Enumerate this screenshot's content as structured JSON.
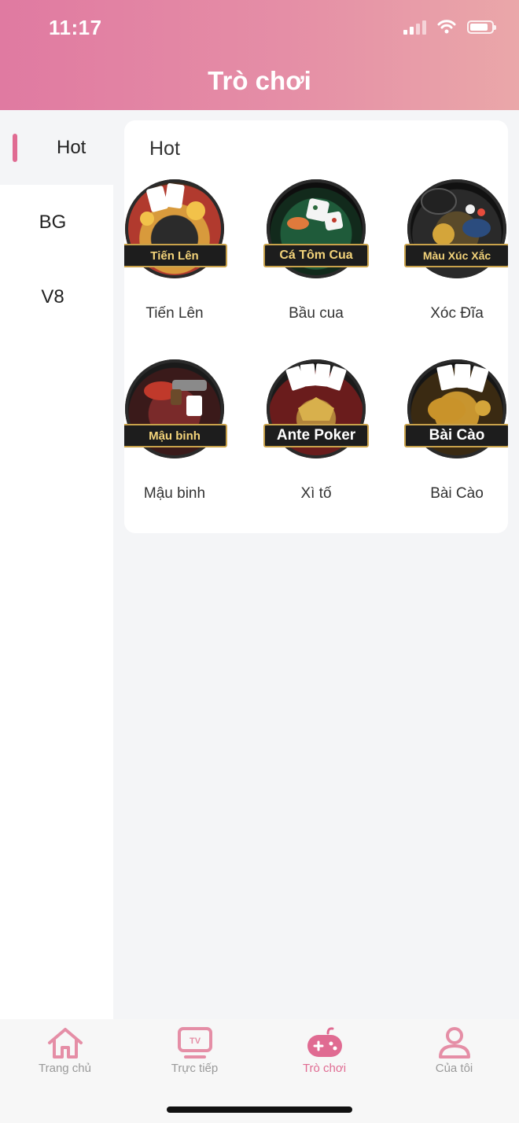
{
  "status": {
    "time": "11:17"
  },
  "header": {
    "title": "Trò chơi"
  },
  "sidebar": {
    "items": [
      {
        "label": "Hot",
        "active": true
      },
      {
        "label": "BG",
        "active": false
      },
      {
        "label": "V8",
        "active": false
      }
    ]
  },
  "section": {
    "title": "Hot",
    "games": [
      {
        "label": "Tiến Lên",
        "badge": "Tiến Lên",
        "icon": "tien-len-icon"
      },
      {
        "label": "Bầu cua",
        "badge": "Cá Tôm Cua",
        "icon": "ca-tom-cua-icon"
      },
      {
        "label": "Xóc Đĩa",
        "badge": "Màu Xúc Xắc",
        "icon": "xoc-dia-icon"
      },
      {
        "label": "Mậu binh",
        "badge": "Mậu binh",
        "icon": "mau-binh-icon"
      },
      {
        "label": "Xì tố",
        "badge": "Ante Poker",
        "icon": "ante-poker-icon"
      },
      {
        "label": "Bài Cào",
        "badge": "Bài Cào",
        "icon": "bai-cao-icon"
      }
    ]
  },
  "tabbar": {
    "items": [
      {
        "label": "Trang chủ",
        "icon": "home-icon",
        "active": false
      },
      {
        "label": "Trực tiếp",
        "icon": "tv-icon",
        "active": false
      },
      {
        "label": "Trò chơi",
        "icon": "gamepad-icon",
        "active": true
      },
      {
        "label": "Của tôi",
        "icon": "user-icon",
        "active": false
      }
    ]
  },
  "colors": {
    "accent": "#e06b92",
    "header_start": "#e07aa1",
    "header_end": "#eaa7a9"
  }
}
